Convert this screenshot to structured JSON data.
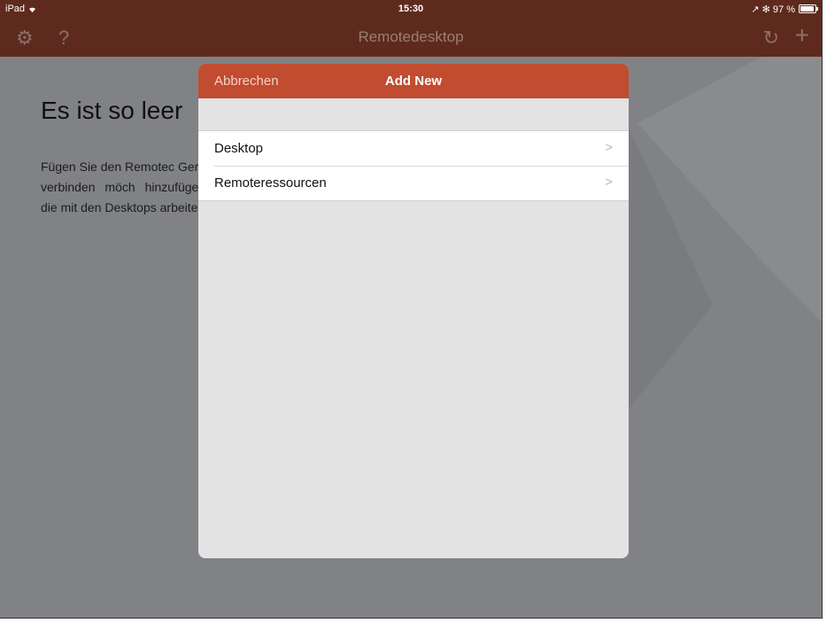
{
  "statusbar": {
    "device": "iPad",
    "wifi_icon": "wifi-icon",
    "time": "15:30",
    "status_right": "↗ ✻ 97 %",
    "battery_icon": "battery-icon"
  },
  "navbar": {
    "title": "Remotedesktop",
    "settings_icon": "⚙",
    "help_icon": "?",
    "sync_icon": "↻",
    "add_icon": "+"
  },
  "background": {
    "empty_title": "Es ist so leer",
    "empty_body": "Fügen Sie den Remotec Gerät verbinden möch hinzufügen, die mit den Desktops arbeiten."
  },
  "modal": {
    "cancel_label": "Abbrechen",
    "title": "Add New",
    "items": [
      {
        "label": "Desktop",
        "chevron": ">"
      },
      {
        "label": "Remoteressourcen",
        "chevron": ">"
      }
    ]
  },
  "colors": {
    "nav_bar": "#5f2a1e",
    "modal_header": "#c14c30",
    "dim_background": "#818286"
  }
}
